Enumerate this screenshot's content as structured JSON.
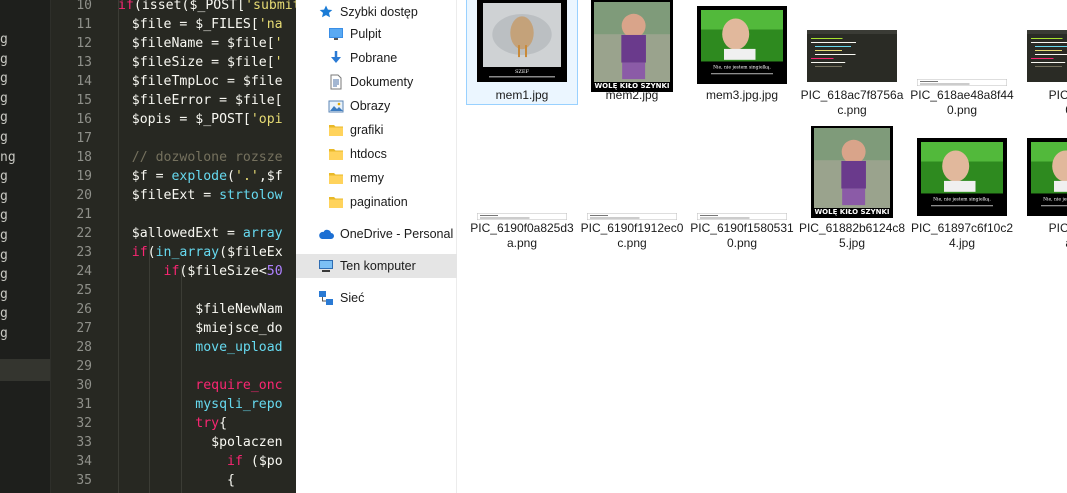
{
  "editor": {
    "side_letters": [
      "g",
      "g",
      "g",
      "g",
      "g",
      "g",
      "ng",
      "g",
      "g",
      "g",
      "g",
      "g",
      "g",
      "g",
      "g",
      "g"
    ],
    "lines": [
      {
        "n": "10",
        "code": [
          {
            "t": "k",
            "x": "if"
          },
          {
            "t": "v",
            "x": "(isset("
          },
          {
            "t": "v",
            "x": "$_POST"
          },
          {
            "t": "v",
            "x": "["
          },
          {
            "t": "s",
            "x": "'submit"
          }
        ]
      },
      {
        "n": "11",
        "code": [
          {
            "t": "v",
            "x": "    $file = $_FILES["
          },
          {
            "t": "s",
            "x": "'na"
          }
        ]
      },
      {
        "n": "12",
        "code": [
          {
            "t": "v",
            "x": "    $fileName = $file["
          },
          {
            "t": "s",
            "x": "'"
          }
        ]
      },
      {
        "n": "13",
        "code": [
          {
            "t": "v",
            "x": "    $fileSize = $file["
          },
          {
            "t": "s",
            "x": "'"
          }
        ]
      },
      {
        "n": "14",
        "code": [
          {
            "t": "v",
            "x": "    $fileTmpLoc = $file"
          }
        ]
      },
      {
        "n": "15",
        "code": [
          {
            "t": "v",
            "x": "    $fileError = $file["
          }
        ]
      },
      {
        "n": "16",
        "code": [
          {
            "t": "v",
            "x": "    $opis = $_POST["
          },
          {
            "t": "s",
            "x": "'opi"
          }
        ]
      },
      {
        "n": "17",
        "code": []
      },
      {
        "n": "18",
        "code": [
          {
            "t": "c",
            "x": "    // dozwolone rozsze"
          }
        ]
      },
      {
        "n": "19",
        "code": [
          {
            "t": "v",
            "x": "    $f = "
          },
          {
            "t": "f",
            "x": "explode"
          },
          {
            "t": "v",
            "x": "("
          },
          {
            "t": "s",
            "x": "'.'"
          },
          {
            "t": "v",
            "x": ",$f"
          }
        ]
      },
      {
        "n": "20",
        "code": [
          {
            "t": "v",
            "x": "    $fileExt = "
          },
          {
            "t": "f",
            "x": "strtolow"
          }
        ]
      },
      {
        "n": "21",
        "code": []
      },
      {
        "n": "22",
        "code": [
          {
            "t": "v",
            "x": "    $allowedExt = "
          },
          {
            "t": "f",
            "x": "array"
          }
        ]
      },
      {
        "n": "23",
        "code": [
          {
            "t": "v",
            "x": "    "
          },
          {
            "t": "k",
            "x": "if"
          },
          {
            "t": "v",
            "x": "("
          },
          {
            "t": "f",
            "x": "in_array"
          },
          {
            "t": "v",
            "x": "($fileEx"
          }
        ]
      },
      {
        "n": "24",
        "code": [
          {
            "t": "v",
            "x": "        "
          },
          {
            "t": "k",
            "x": "if"
          },
          {
            "t": "v",
            "x": "($fileSize<"
          },
          {
            "t": "n",
            "x": "50"
          }
        ]
      },
      {
        "n": "25",
        "code": []
      },
      {
        "n": "26",
        "code": [
          {
            "t": "v",
            "x": "            $fileNewNam"
          }
        ]
      },
      {
        "n": "27",
        "code": [
          {
            "t": "v",
            "x": "            $miejsce_do"
          }
        ]
      },
      {
        "n": "28",
        "code": [
          {
            "t": "f",
            "x": "            move_upload"
          }
        ]
      },
      {
        "n": "29",
        "code": []
      },
      {
        "n": "30",
        "code": [
          {
            "t": "k",
            "x": "            require_onc"
          }
        ]
      },
      {
        "n": "31",
        "code": [
          {
            "t": "f",
            "x": "            mysqli_repo"
          }
        ]
      },
      {
        "n": "32",
        "code": [
          {
            "t": "k",
            "x": "            try"
          },
          {
            "t": "v",
            "x": "{"
          }
        ]
      },
      {
        "n": "33",
        "code": [
          {
            "t": "v",
            "x": "              $polaczen"
          }
        ]
      },
      {
        "n": "34",
        "code": [
          {
            "t": "v",
            "x": "                "
          },
          {
            "t": "k",
            "x": "if"
          },
          {
            "t": "v",
            "x": " ($po"
          }
        ]
      },
      {
        "n": "35",
        "code": [
          {
            "t": "v",
            "x": "                {"
          }
        ]
      }
    ]
  },
  "nav": {
    "items": [
      {
        "label": "Szybki dostęp",
        "icon": "star-icon",
        "pinned": false,
        "selected": false
      },
      {
        "label": "Pulpit",
        "icon": "desktop-icon",
        "pinned": true,
        "selected": false
      },
      {
        "label": "Pobrane",
        "icon": "download-icon",
        "pinned": true,
        "selected": false
      },
      {
        "label": "Dokumenty",
        "icon": "document-icon",
        "pinned": true,
        "selected": false
      },
      {
        "label": "Obrazy",
        "icon": "pictures-icon",
        "pinned": true,
        "selected": false
      },
      {
        "label": "grafiki",
        "icon": "folder-icon",
        "pinned": false,
        "selected": false
      },
      {
        "label": "htdocs",
        "icon": "folder-icon",
        "pinned": false,
        "selected": false
      },
      {
        "label": "memy",
        "icon": "folder-icon",
        "pinned": false,
        "selected": false
      },
      {
        "label": "pagination",
        "icon": "folder-icon",
        "pinned": false,
        "selected": false
      },
      {
        "label": "OneDrive - Personal",
        "icon": "cloud-icon",
        "pinned": false,
        "selected": false
      },
      {
        "label": "Ten komputer",
        "icon": "computer-icon",
        "pinned": false,
        "selected": true
      },
      {
        "label": "Sieć",
        "icon": "network-icon",
        "pinned": false,
        "selected": false
      }
    ]
  },
  "files": {
    "row1": [
      {
        "name": "mem1.jpg",
        "kind": "meme-bird",
        "selected": true
      },
      {
        "name": "mem2.jpg",
        "kind": "meme-kid",
        "selected": false
      },
      {
        "name": "mem3.jpg.jpg",
        "kind": "meme-grass",
        "selected": false
      },
      {
        "name": "PIC_618ac7f8756ac.png",
        "kind": "code-dark",
        "selected": false
      },
      {
        "name": "PIC_618ae48a8f440.png",
        "kind": "white-strip",
        "selected": false
      },
      {
        "name": "PIC_618",
        "name2": "0e",
        "kind": "code-dark",
        "selected": false
      }
    ],
    "row2": [
      {
        "name": "PIC_6190f0a825d3a.png",
        "kind": "white-strip",
        "selected": false
      },
      {
        "name": "PIC_6190f1912ec0c.png",
        "kind": "white-strip",
        "selected": false
      },
      {
        "name": "PIC_6190f15805310.png",
        "kind": "white-strip",
        "selected": false
      },
      {
        "name": "PIC_61882b6124c85.jpg",
        "kind": "meme-kid",
        "selected": false
      },
      {
        "name": "PIC_61897c6f10c24.jpg",
        "kind": "meme-grass",
        "selected": false
      },
      {
        "name": "PIC_618",
        "name2": "a8",
        "kind": "meme-grass",
        "selected": false
      }
    ],
    "meme_text": {
      "mem1_caption": "SZEF",
      "kid_caption": "WOLĘ KIŁO SZYNKI",
      "grass_caption": "Nie, nie jestem singielką."
    }
  }
}
